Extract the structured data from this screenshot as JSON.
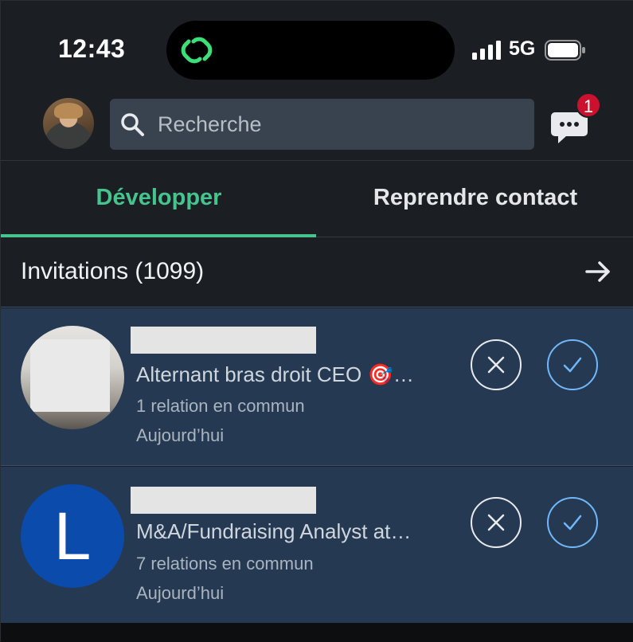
{
  "status_bar": {
    "time": "12:43",
    "network": "5G"
  },
  "header": {
    "search_placeholder": "Recherche",
    "messaging_badge": "1"
  },
  "tabs": [
    {
      "label": "Développer",
      "active": true
    },
    {
      "label": "Reprendre contact",
      "active": false
    }
  ],
  "invitations": {
    "title": "Invitations (1099)",
    "items": [
      {
        "headline": "Alternant bras droit CEO 🎯…",
        "mutual": "1 relation en commun",
        "time": "Aujourd’hui"
      },
      {
        "avatar_letter": "L",
        "headline": "M&A/Fundraising Analyst at…",
        "mutual": "7 relations en commun",
        "time": "Aujourd’hui"
      }
    ]
  },
  "colors": {
    "accent_green": "#45c48d",
    "row_background": "#253a52",
    "accept_blue": "#71b7fb",
    "badge_red": "#cb112d"
  }
}
